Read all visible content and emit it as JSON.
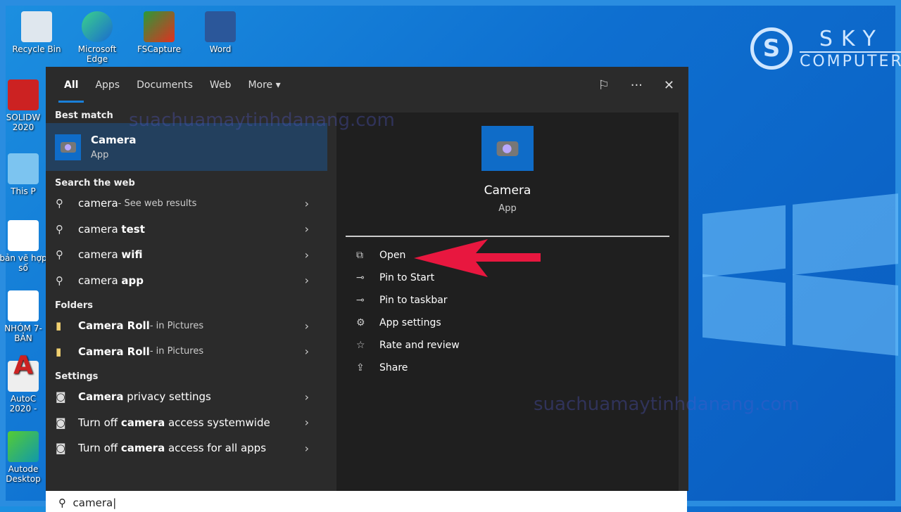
{
  "desktop": {
    "icons": [
      "Recycle Bin",
      "Microsoft Edge",
      "FSCapture",
      "Word"
    ],
    "left_icons": [
      "SOLIDW 2020",
      "This P",
      "bản vẽ hợp số",
      "NHÓM 7-BẢN",
      "AutoC 2020 -",
      "Autode Desktop"
    ]
  },
  "logo": {
    "line1": "SKY",
    "line2": "COMPUTER"
  },
  "watermark": "suachuamaytinhdanang.com",
  "tabs": [
    "All",
    "Apps",
    "Documents",
    "Web",
    "More"
  ],
  "toolbar": {
    "feedback": "feedback-icon",
    "more": "···",
    "close": "✕"
  },
  "sections": {
    "best": "Best match",
    "web": "Search the web",
    "folders": "Folders",
    "settings": "Settings"
  },
  "best_match": {
    "name": "Camera",
    "type": "App"
  },
  "web": [
    {
      "a": "camera",
      "b": " - See web results",
      "sub": true
    },
    {
      "a": "camera ",
      "b": "test"
    },
    {
      "a": "camera ",
      "b": "wifi"
    },
    {
      "a": "camera ",
      "b": "app"
    }
  ],
  "folders": [
    {
      "a": "Camera Roll",
      "b": " - in Pictures"
    },
    {
      "a": "Camera Roll",
      "b": " - in Pictures"
    }
  ],
  "settings": [
    {
      "pre": "",
      "bold": "Camera",
      "post": " privacy settings"
    },
    {
      "pre": "Turn off ",
      "bold": "camera",
      "post": " access systemwide"
    },
    {
      "pre": "Turn off ",
      "bold": "camera",
      "post": " access for all apps"
    }
  ],
  "detail": {
    "name": "Camera",
    "type": "App",
    "actions": [
      "Open",
      "Pin to Start",
      "Pin to taskbar",
      "App settings",
      "Rate and review",
      "Share"
    ]
  },
  "search": {
    "value": "camera"
  },
  "colors": {
    "accent": "#1a7fd8",
    "arrow": "#e8173f"
  }
}
